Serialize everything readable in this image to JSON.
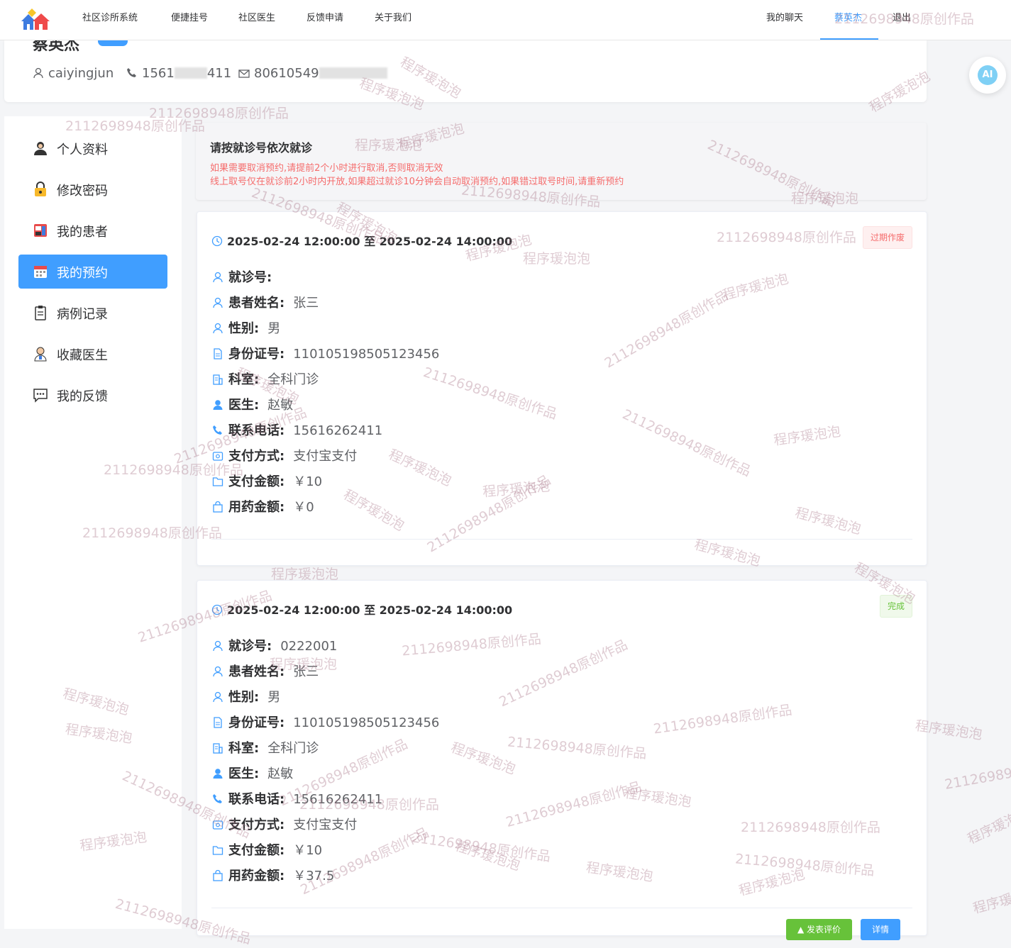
{
  "nav": {
    "items": [
      "社区诊所系统",
      "便捷挂号",
      "社区医生",
      "反馈申请",
      "关于我们"
    ],
    "chat": "我的聊天",
    "user": "蔡英杰",
    "logout": "退出"
  },
  "profile": {
    "name": "蔡英杰",
    "username": "caiyingjun",
    "phone_a": "1561",
    "phone_b": "411",
    "email_a": "80610549"
  },
  "sidebar": {
    "items": [
      {
        "label": "个人资料",
        "icon": "person-icon"
      },
      {
        "label": "修改密码",
        "icon": "lock-icon"
      },
      {
        "label": "我的患者",
        "icon": "patient-icon"
      },
      {
        "label": "我的预约",
        "icon": "calendar-icon"
      },
      {
        "label": "病例记录",
        "icon": "clipboard-icon"
      },
      {
        "label": "收藏医生",
        "icon": "doctor-icon"
      },
      {
        "label": "我的反馈",
        "icon": "chat-icon"
      }
    ],
    "active_index": 3
  },
  "notice": {
    "title": "请按就诊号依次就诊",
    "line1": "如果需要取消预约,请提前2个小时进行取消,否则取消无效",
    "line2": "线上取号仅在就诊前2小时内开放,如果超过就诊10分钟会自动取消预约,如果错过取号时间,请重新预约"
  },
  "labels": {
    "visit_no": "就诊号:",
    "patient": "患者姓名:",
    "gender": "性别:",
    "id_no": "身份证号:",
    "dept": "科室:",
    "doctor": "医生:",
    "phone": "联系电话:",
    "pay_method": "支付方式:",
    "pay_amount": "支付金额:",
    "drug_amount": "用药金额:"
  },
  "appointments": [
    {
      "time": "2025-02-24 12:00:00 至 2025-02-24 14:00:00",
      "status": "过期作废",
      "visit_no": "",
      "patient": "张三",
      "gender": "男",
      "id_no": "110105198505123456",
      "dept": "全科门诊",
      "doctor": "赵敏",
      "phone": "15616262411",
      "pay_method": "支付宝支付",
      "pay_amount": "￥10",
      "drug_amount": "￥0"
    },
    {
      "time": "2025-02-24 12:00:00 至 2025-02-24 14:00:00",
      "status": "完成",
      "visit_no": "0222001",
      "patient": "张三",
      "gender": "男",
      "id_no": "110105198505123456",
      "dept": "全科门诊",
      "doctor": "赵敏",
      "phone": "15616262411",
      "pay_method": "支付宝支付",
      "pay_amount": "￥10",
      "drug_amount": "￥37.5"
    }
  ],
  "buttons": {
    "review": "▲ 发表评价",
    "detail": "详情"
  },
  "ai_label": "AI",
  "watermarks": [
    "2112698948原创作品",
    "程序瑗泡泡"
  ],
  "colors": {
    "accent": "#409eff",
    "danger": "#f56c6c",
    "success": "#67c23a"
  }
}
